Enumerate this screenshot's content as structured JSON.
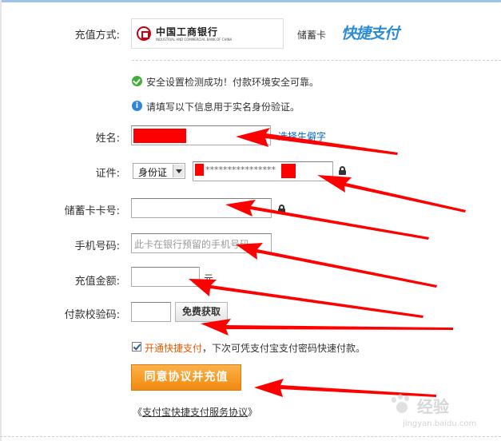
{
  "payment": {
    "method_label": "充值方式:",
    "bank_logo_name": "中国工商银行",
    "bank_logo_subtitle": "INDUSTRIAL AND COMMERCIAL BANK OF CHINA",
    "card_type": "储蓄卡",
    "quick_pay_brand": "快捷支付"
  },
  "notices": {
    "security_ok": "安全设置检测成功！付款环境安全可靠。",
    "info_prompt": "请填写以下信息用于实名身份验证。"
  },
  "form": {
    "name_label": "姓名:",
    "name_link": "选择生僻字",
    "id_label": "证件:",
    "id_type_selected": "身份证",
    "id_number_masked": "****************",
    "card_label": "储蓄卡卡号:",
    "phone_label": "手机号码:",
    "phone_placeholder": "此卡在银行预留的手机号码",
    "amount_label": "充值金额:",
    "amount_unit": "元",
    "code_label": "付款校验码:",
    "get_code_button": "免费获取",
    "quickpay_checkbox_checked": true,
    "quickpay_link": "开通快捷支付",
    "quickpay_desc": "，下次可凭支付宝支付密码快速付款。",
    "submit_button": "同意协议并充值",
    "agreement_prefix": "《",
    "agreement_link": "支付宝快捷支付服务协议",
    "agreement_suffix": "》"
  },
  "watermark": {
    "text": "经验",
    "url": "jingyan.baidu.com"
  },
  "colors": {
    "accent_orange": "#f7941d",
    "link_blue": "#0066cc",
    "link_orange": "#e55b00",
    "annotation_red": "#ff0000",
    "quickpay_blue": "#2a8bd6"
  }
}
